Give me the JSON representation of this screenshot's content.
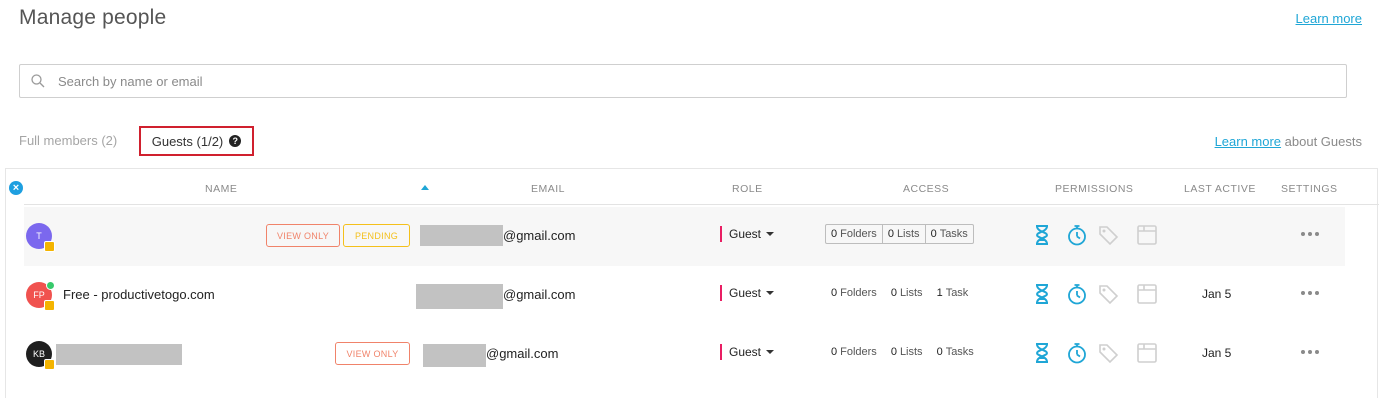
{
  "page": {
    "title": "Manage people",
    "learn_more": "Learn more"
  },
  "search": {
    "placeholder": "Search by name or email"
  },
  "tabs": {
    "full_members": "Full members (2)",
    "guests": "Guests (1/2)"
  },
  "guests_help": {
    "link": "Learn more",
    "suffix": " about Guests"
  },
  "table": {
    "columns": {
      "name": "NAME",
      "email": "EMAIL",
      "role": "ROLE",
      "access": "ACCESS",
      "permissions": "PERMISSIONS",
      "last_active": "LAST ACTIVE",
      "settings": "SETTINGS"
    },
    "rows": [
      {
        "avatar_initials": "T",
        "avatar_color": "#7b68ee",
        "name": "",
        "tags": [
          "VIEW ONLY",
          "PENDING"
        ],
        "email_suffix": "@gmail.com",
        "role": "Guest",
        "access": {
          "folders": "0",
          "folders_label": "Folders",
          "lists": "0",
          "lists_label": "Lists",
          "tasks": "0",
          "tasks_label": "Tasks"
        },
        "last_active": ""
      },
      {
        "avatar_initials": "FP",
        "avatar_color": "#f0524f",
        "name": "Free - productivetogo.com",
        "tags": [],
        "email_suffix": "@gmail.com",
        "role": "Guest",
        "access": {
          "folders": "0",
          "folders_label": "Folders",
          "lists": "0",
          "lists_label": "Lists",
          "tasks": "1",
          "tasks_label": "Task"
        },
        "last_active": "Jan 5"
      },
      {
        "avatar_initials": "KB",
        "avatar_color": "#1f1f1f",
        "name": "",
        "tags": [
          "VIEW ONLY"
        ],
        "email_suffix": "@gmail.com",
        "role": "Guest",
        "access": {
          "folders": "0",
          "folders_label": "Folders",
          "lists": "0",
          "lists_label": "Lists",
          "tasks": "0",
          "tasks_label": "Tasks"
        },
        "last_active": "Jan 5"
      }
    ]
  },
  "colors": {
    "accent": "#1fa6d6",
    "highlight_border": "#d0202e",
    "role_bar": "#e91e63",
    "view_only": "#f0836a",
    "pending": "#f4c01b"
  },
  "icons": {
    "search": "search-icon",
    "help": "help-icon",
    "close": "close-icon",
    "permissions": [
      "hourglass-icon",
      "timer-icon",
      "tags-icon",
      "window-icon"
    ],
    "settings": "more-dots-icon"
  }
}
